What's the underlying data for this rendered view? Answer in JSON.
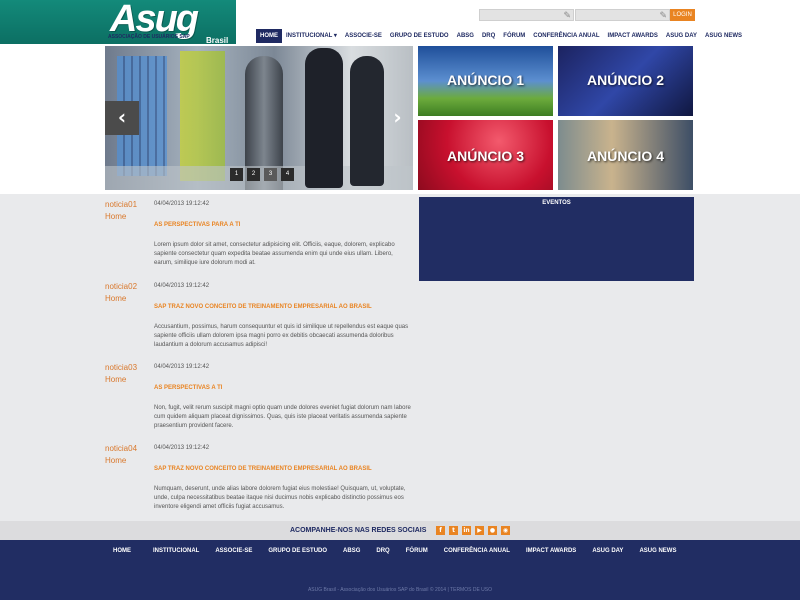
{
  "header": {
    "logo_text": "Asug",
    "logo_subtitle": "ASSOCIAÇÃO DE USUÁRIOS SAP",
    "logo_country": "Brasil",
    "login_label": "LOGIN"
  },
  "nav": {
    "items": [
      {
        "label": "HOME",
        "active": true
      },
      {
        "label": "INSTITUCIONAL ▾",
        "active": false
      },
      {
        "label": "ASSOCIE-SE",
        "active": false
      },
      {
        "label": "GRUPO DE ESTUDO",
        "active": false
      },
      {
        "label": "ABSG",
        "active": false
      },
      {
        "label": "DRQ",
        "active": false
      },
      {
        "label": "FÓRUM",
        "active": false
      },
      {
        "label": "CONFERÊNCIA ANUAL",
        "active": false
      },
      {
        "label": "IMPACT AWARDS",
        "active": false
      },
      {
        "label": "ASUG DAY",
        "active": false
      },
      {
        "label": "ASUG NEWS",
        "active": false
      }
    ]
  },
  "slider": {
    "prev_icon": "‹",
    "next_icon": "›",
    "pages": [
      "1",
      "2",
      "3",
      "4"
    ],
    "active_page": "3"
  },
  "ads": [
    "ANÚNCIO 1",
    "ANÚNCIO 2",
    "ANÚNCIO 3",
    "ANÚNCIO 4"
  ],
  "news": [
    {
      "code": "noticia01",
      "section": "Home",
      "date": "04/04/2013 19:12:42",
      "title": "AS PERSPECTIVAS PARA A TI",
      "body": "Lorem ipsum dolor sit amet, consectetur adipisicing elit. Officiis, eaque, dolorem, explicabo sapiente consectetur quam expedita beatae assumenda enim qui unde eius ullam. Libero, earum, similique iure dolorum modi at."
    },
    {
      "code": "noticia02",
      "section": "Home",
      "date": "04/04/2013 19:12:42",
      "title": "SAP TRAZ NOVO CONCEITO DE TREINAMENTO EMPRESARIAL AO BRASIL",
      "body": "Accusantium, possimus, harum consequuntur et quis id similique ut repellendus est eaque quas sapiente officiis ullam dolorem ipsa magni porro ex debitis obcaecati assumenda doloribus laudantium a dolorum accusamus adipisci!"
    },
    {
      "code": "noticia03",
      "section": "Home",
      "date": "04/04/2013 19:12:42",
      "title": "AS PERSPECTIVAS A TI",
      "body": "Non, fugit, velit rerum suscipit magni optio quam unde dolores eveniet fugiat dolorum nam labore cum quidem aliquam placeat dignissimos. Quas, quis iste placeat veritatis assumenda sapiente praesentium provident facere."
    },
    {
      "code": "noticia04",
      "section": "Home",
      "date": "04/04/2013 19:12:42",
      "title": "SAP TRAZ NOVO CONCEITO DE TREINAMENTO EMPRESARIAL AO BRASIL",
      "body": "Numquam, deserunt, unde alias labore dolorem fugiat eius molestiae! Quisquam, ut, voluptate, unde, culpa necessitatibus beatae itaque nisi ducimus nobis explicabo distinctio possimus eos inventore eligendi amet officiis fugiat accusamus."
    }
  ],
  "events": {
    "title": "EVENTOS"
  },
  "social": {
    "title": "ACOMPANHE-NOS NAS REDES SOCIAIS",
    "icons": [
      {
        "name": "facebook-icon",
        "glyph": "f"
      },
      {
        "name": "twitter-icon",
        "glyph": "t"
      },
      {
        "name": "linkedin-icon",
        "glyph": "in"
      },
      {
        "name": "youtube-icon",
        "glyph": "▶"
      },
      {
        "name": "flickr-icon",
        "glyph": "●"
      },
      {
        "name": "rss-icon",
        "glyph": "◉"
      }
    ]
  },
  "footer": {
    "items": [
      "HOME",
      "INSTITUCIONAL",
      "ASSOCIE-SE",
      "GRUPO DE ESTUDO",
      "ABSG",
      "DRQ",
      "FÓRUM",
      "CONFERÊNCIA ANUAL",
      "IMPACT AWARDS",
      "ASUG DAY",
      "ASUG NEWS"
    ],
    "copyright": "ASUG Brasil - Associação dos Usuários SAP do Brasil © 2014 | TERMOS DE USO"
  },
  "colors": {
    "navy": "#212d63",
    "orange": "#e98422",
    "teal": "#138a7a",
    "content_bg": "#e9eaec"
  }
}
